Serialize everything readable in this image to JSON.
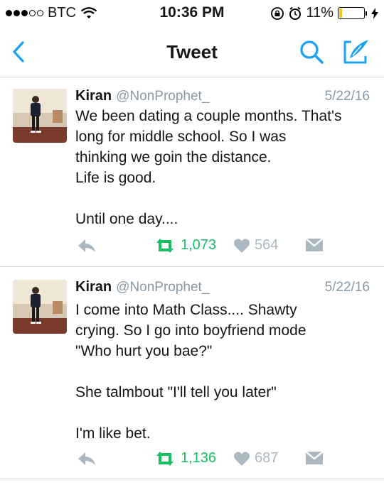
{
  "status_bar": {
    "carrier": "BTC",
    "time": "10:36 PM",
    "battery_percent": "11%",
    "battery_level": 0.11,
    "signal_bars_filled": 3,
    "signal_bars_total": 5
  },
  "nav": {
    "title": "Tweet",
    "accent_color": "#1da1f2",
    "back_icon": "chevron-left-icon",
    "search_icon": "search-icon",
    "compose_icon": "compose-icon"
  },
  "tweets": [
    {
      "name": "Kiran",
      "handle": "@NonProphet_",
      "date": "5/22/16",
      "text": "We been dating a couple months. That's\nlong for middle school. So I was\nthinking we goin the distance.\nLife is good.\n\nUntil one day....",
      "retweets": "1,073",
      "likes": "564"
    },
    {
      "name": "Kiran",
      "handle": "@NonProphet_",
      "date": "5/22/16",
      "text": "I come into Math Class.... Shawty\ncrying. So I go into boyfriend mode\n\"Who hurt you bae?\"\n\nShe talmbout \"I'll tell you later\"\n\nI'm like bet.",
      "retweets": "1,136",
      "likes": "687"
    }
  ],
  "colors": {
    "retweet": "#17bf63",
    "icon_gray": "#aab8c2",
    "handle_gray": "#8899a6"
  }
}
